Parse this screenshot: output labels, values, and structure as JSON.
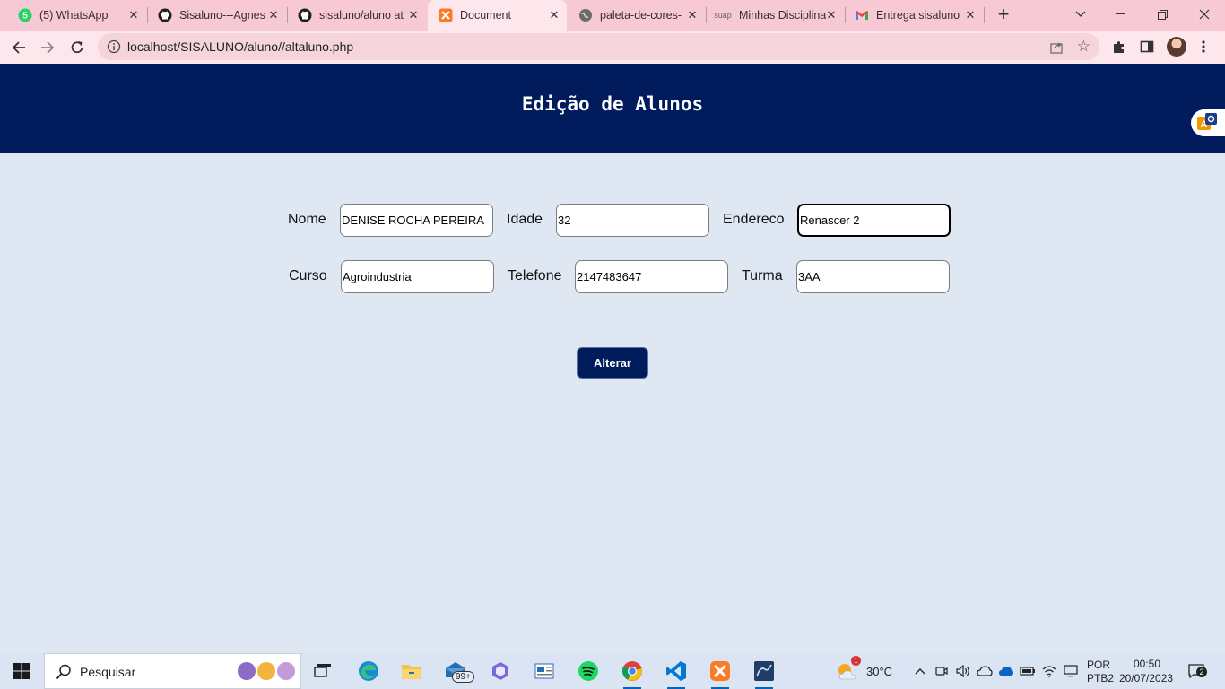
{
  "browser": {
    "tabs": [
      {
        "title": "(5) WhatsApp",
        "icon": "whatsapp-icon"
      },
      {
        "title": "Sisaluno---Agnes",
        "icon": "github-icon"
      },
      {
        "title": "sisaluno/aluno at",
        "icon": "github-icon"
      },
      {
        "title": "Document",
        "icon": "xampp-icon",
        "active": true
      },
      {
        "title": "paleta-de-cores-",
        "icon": "globe-icon"
      },
      {
        "title": "Minhas Disciplina",
        "icon": "suap-icon",
        "icon_text": "suap"
      },
      {
        "title": "Entrega sisaluno",
        "icon": "gmail-icon"
      }
    ],
    "url": "localhost/SISALUNO/aluno//altaluno.php"
  },
  "page": {
    "title": "Edição de Alunos",
    "form": {
      "nome_label": "Nome",
      "nome_value": "DENISE ROCHA PEREIRA",
      "idade_label": "Idade",
      "idade_value": "32",
      "endereco_label": "Endereco",
      "endereco_value": "Renascer 2",
      "curso_label": "Curso",
      "curso_value": "Agroindustria",
      "telefone_label": "Telefone",
      "telefone_value": "2147483647",
      "turma_label": "Turma",
      "turma_value": "3AA",
      "submit_label": "Alterar"
    }
  },
  "taskbar": {
    "search_placeholder": "Pesquisar",
    "mail_badge": "99+",
    "weather_temp": "30°C",
    "weather_badge": "1",
    "lang_line1": "POR",
    "lang_line2": "PTB2",
    "time": "00:50",
    "date": "20/07/2023",
    "notification_count": "2"
  },
  "colors": {
    "header": "#001c5d",
    "page_bg": "#dfe7f3",
    "tabbar": "#f7c9d4",
    "toolbar": "#fde7ec"
  }
}
